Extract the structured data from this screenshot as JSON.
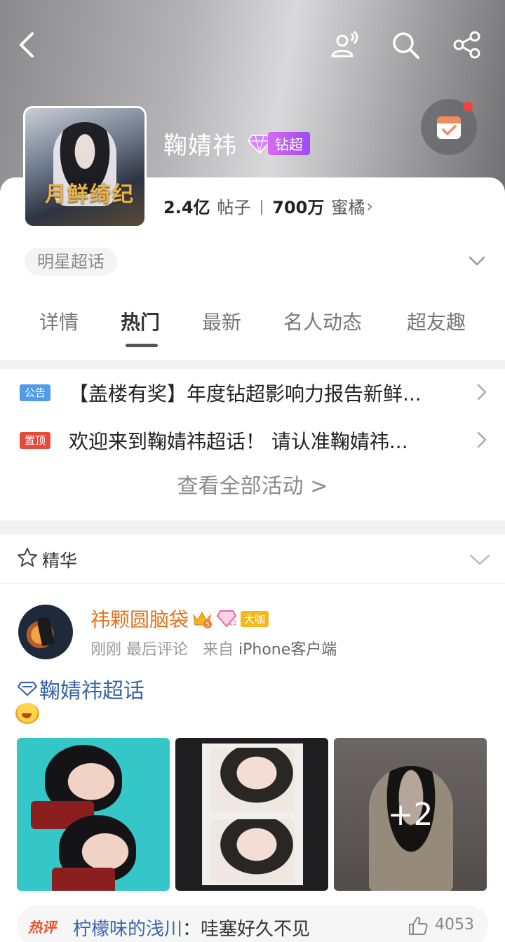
{
  "header": {
    "back_icon": "chevron-left-icon",
    "contacts_icon": "users-wave-icon",
    "search_icon": "search-icon",
    "share_icon": "share-icon",
    "title": "鞠婧祎",
    "rank_badge": "钻超",
    "checkin_icon": "calendar-check-icon"
  },
  "avatar": {
    "logo_text": "月鲜绮纪"
  },
  "stats": {
    "posts_num": "2.4亿",
    "posts_label": "帖子",
    "fans_num": "700万",
    "fans_label": "蜜橘"
  },
  "tag": "明星超话",
  "tabs": [
    "详情",
    "热门",
    "最新",
    "名人动态",
    "超友趣"
  ],
  "active_tab": "热门",
  "notices": [
    {
      "tag": "公告",
      "color": "#4f9ce8",
      "text": "【盖楼有奖】年度钻超影响力报告新鲜..."
    },
    {
      "tag": "置顶",
      "color": "#e84a3a",
      "text": "欢迎来到鞠婧祎超话！ 请认准鞠婧祎..."
    }
  ],
  "all_activities": "查看全部活动 >",
  "featured": {
    "label": "精华"
  },
  "post": {
    "author": "祎颗圆脑袋",
    "author_badge": "大咖",
    "level": "12",
    "meta_time": "刚刚 最后评论",
    "meta_from": "来自",
    "meta_source": "iPhone客户端",
    "topic": "鞠婧祎超话",
    "more_images": "+2",
    "hot_label": "热评",
    "hot_user": "柠檬味的浅川",
    "hot_text": "：哇塞好久不见",
    "likes": "4053"
  },
  "colors": {
    "accent": "#e0741c",
    "link": "#3a66a8",
    "badge_purple": "#b45ef2"
  }
}
